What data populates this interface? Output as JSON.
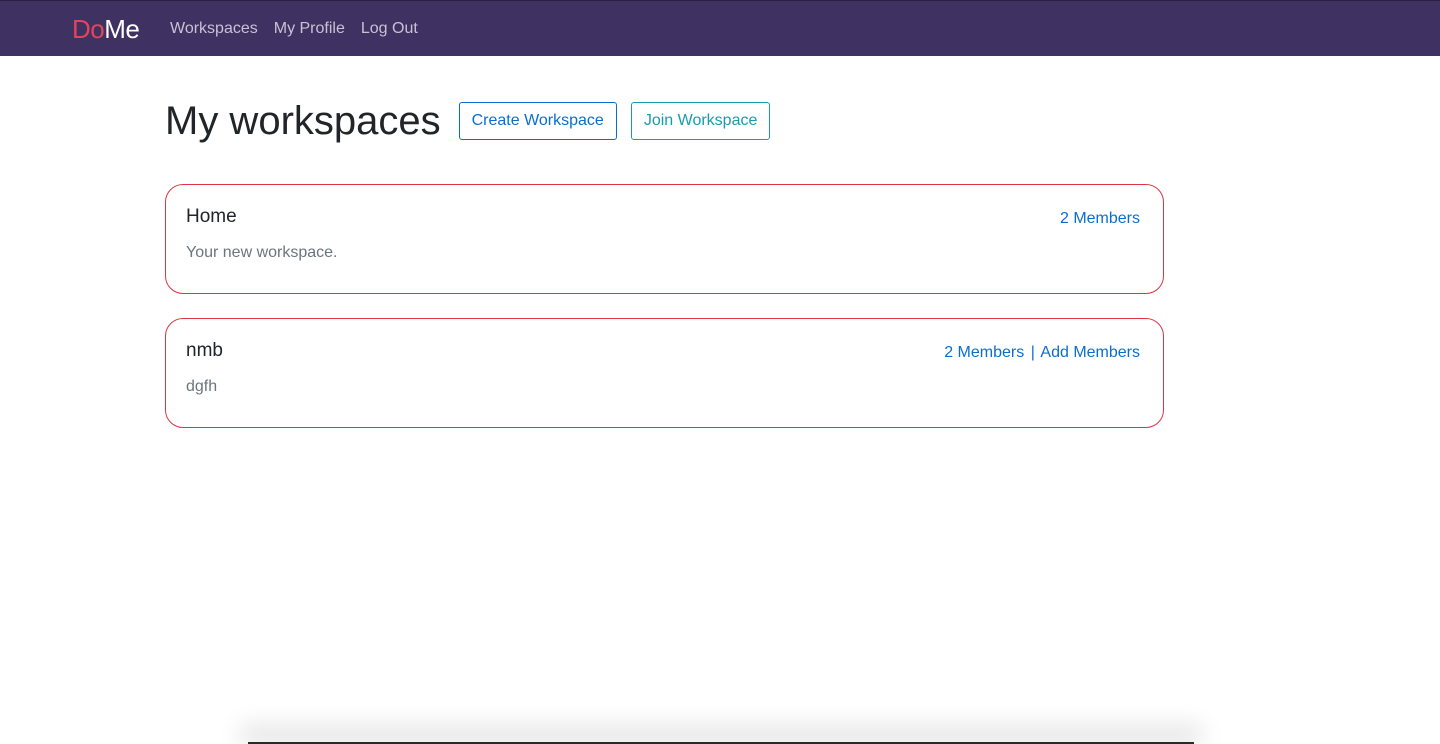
{
  "navbar": {
    "brand_first": "Do",
    "brand_second": "Me",
    "links": [
      "Workspaces",
      "My Profile",
      "Log Out"
    ]
  },
  "header": {
    "title": "My workspaces",
    "create_label": "Create Workspace",
    "join_label": "Join Workspace"
  },
  "workspaces": [
    {
      "name": "Home",
      "description": "Your new workspace.",
      "members_label": "2 Members",
      "add_label": ""
    },
    {
      "name": "nmb",
      "description": "dgfh",
      "members_label": "2 Members",
      "separator": "|",
      "add_label": "Add Members"
    }
  ],
  "colors": {
    "navbar_bg": "#3f3162",
    "brand_accent": "#e0455c",
    "link_blue": "#0a6ed1",
    "info_teal": "#1a9bac",
    "card_border": "#dc3545"
  }
}
